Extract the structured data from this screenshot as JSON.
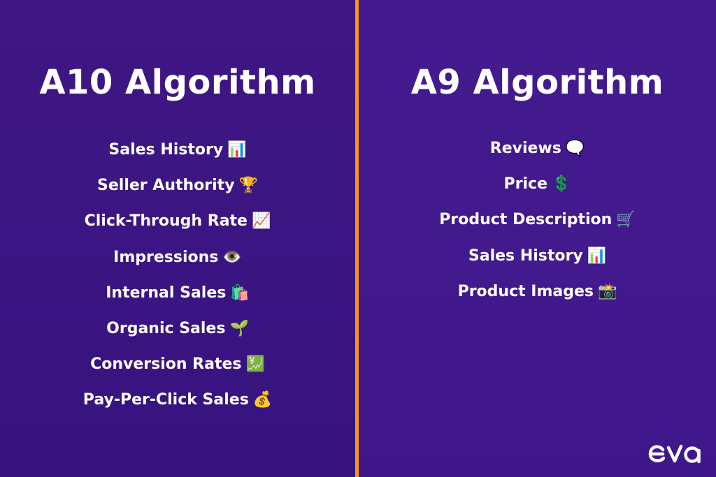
{
  "left_panel": {
    "title": "A10 Algorithm",
    "items": [
      {
        "label": "Sales History",
        "icon": "bar-chart-icon",
        "emoji": "📊"
      },
      {
        "label": "Seller Authority",
        "icon": "trophy-icon",
        "emoji": "🏆"
      },
      {
        "label": "Click-Through Rate",
        "icon": "chart-increasing-icon",
        "emoji": "📈"
      },
      {
        "label": "Impressions",
        "icon": "eye-icon",
        "emoji": "👁️"
      },
      {
        "label": "Internal Sales",
        "icon": "shopping-bags-icon",
        "emoji": "🛍️"
      },
      {
        "label": "Organic Sales",
        "icon": "seedling-icon",
        "emoji": "🌱"
      },
      {
        "label": "Conversion Rates",
        "icon": "chart-yen-icon",
        "emoji": "💹"
      },
      {
        "label": "Pay-Per-Click Sales",
        "icon": "money-bag-icon",
        "emoji": "💰"
      }
    ]
  },
  "right_panel": {
    "title": "A9 Algorithm",
    "items": [
      {
        "label": "Reviews",
        "icon": "speech-balloon-icon",
        "emoji": "🗨️"
      },
      {
        "label": "Price",
        "icon": "dollar-sign-icon",
        "emoji": "💲"
      },
      {
        "label": "Product Description",
        "icon": "shopping-cart-icon",
        "emoji": "🛒"
      },
      {
        "label": "Sales History",
        "icon": "bar-chart-icon",
        "emoji": "📊"
      },
      {
        "label": "Product Images",
        "icon": "camera-flash-icon",
        "emoji": "📸"
      }
    ]
  },
  "brand": {
    "logo_text": "eva"
  },
  "colors": {
    "background": "#3e1785",
    "divider": "#f7931e",
    "text": "#ffffff"
  }
}
